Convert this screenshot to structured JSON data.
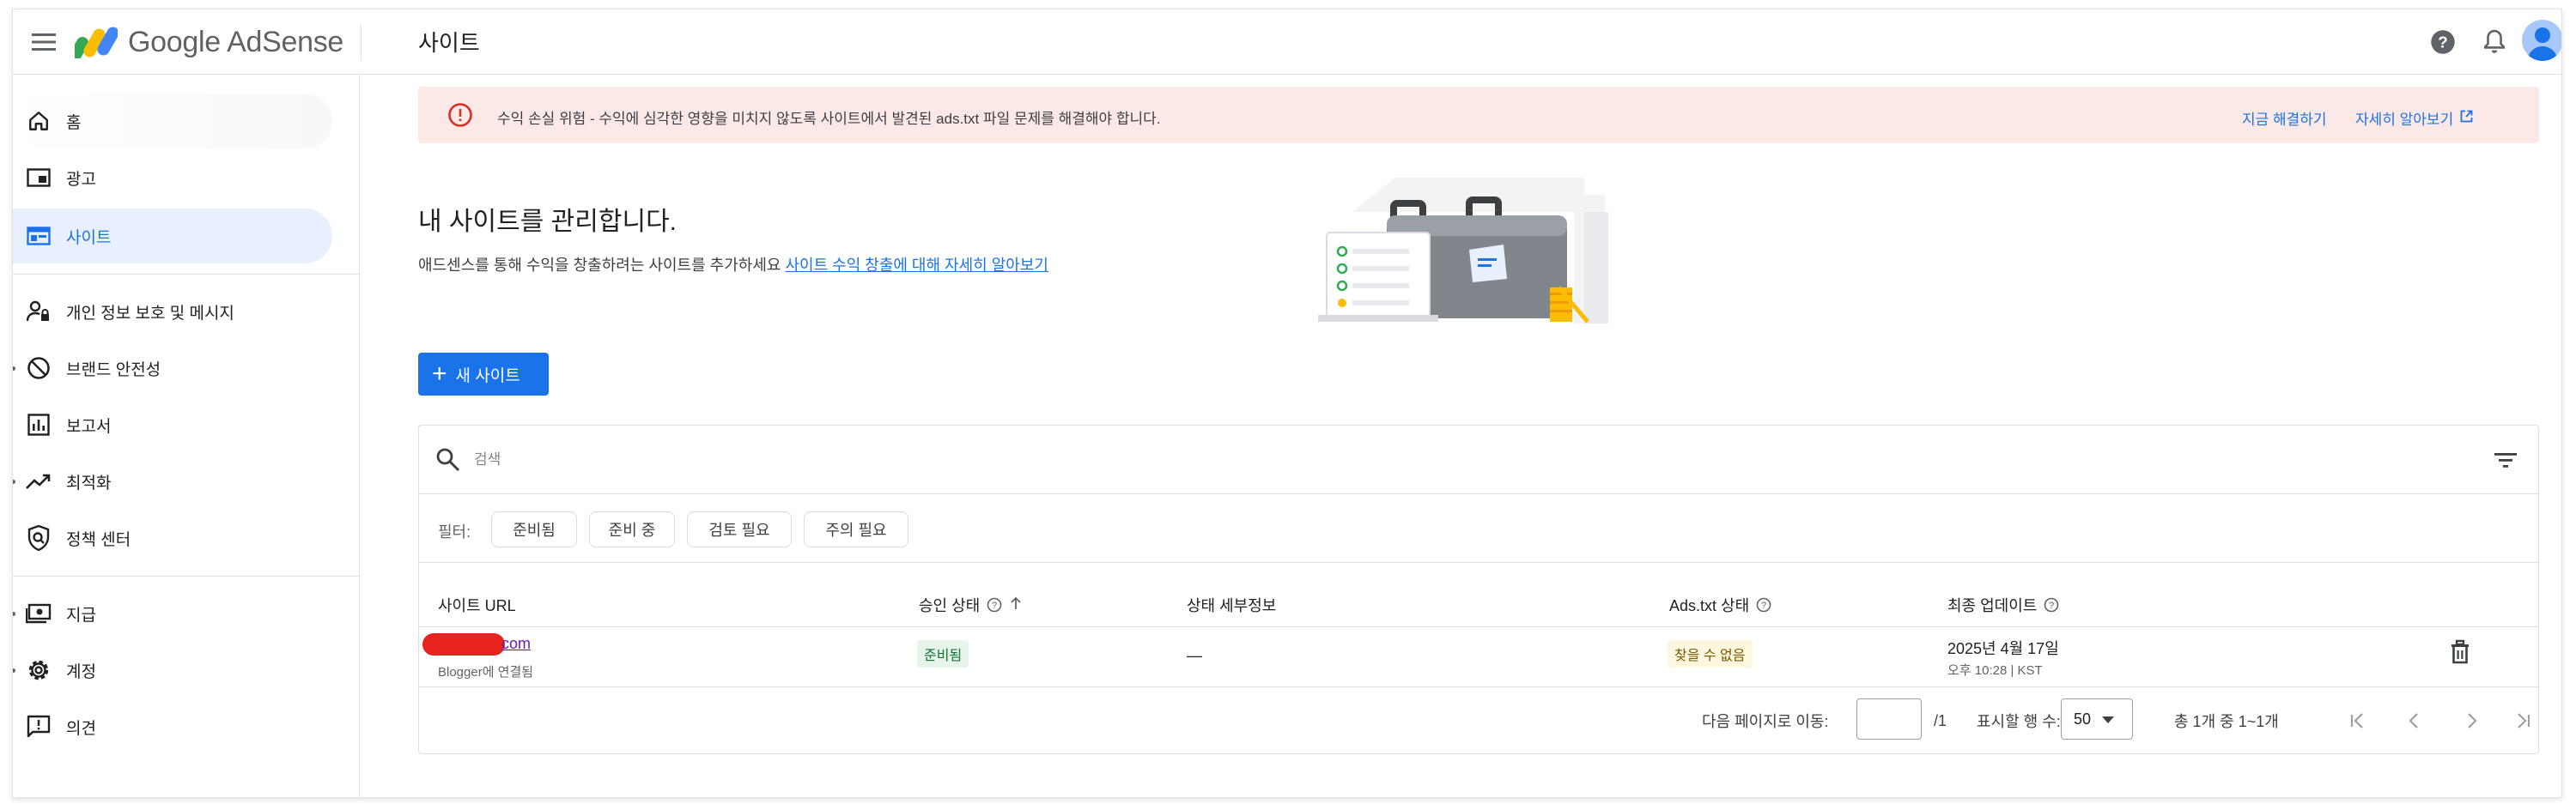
{
  "header": {
    "brand_google": "Google",
    "brand_product": "AdSense",
    "page_title": "사이트",
    "icons": [
      "menu-icon",
      "help-icon",
      "bell-icon",
      "avatar"
    ]
  },
  "sidebar": {
    "items": [
      {
        "label": "홈",
        "icon": "home-icon"
      },
      {
        "label": "광고",
        "icon": "ads-icon"
      },
      {
        "label": "사이트",
        "icon": "sites-icon",
        "active": true
      },
      {
        "label": "개인 정보 보호 및 메시지",
        "icon": "privacy-icon"
      },
      {
        "label": "브랜드 안전성",
        "icon": "brand-safety-icon"
      },
      {
        "label": "보고서",
        "icon": "reports-icon"
      },
      {
        "label": "최적화",
        "icon": "optimization-icon"
      },
      {
        "label": "정책 센터",
        "icon": "policy-icon"
      },
      {
        "label": "지급",
        "icon": "payments-icon"
      },
      {
        "label": "계정",
        "icon": "account-icon"
      },
      {
        "label": "의견",
        "icon": "feedback-icon"
      }
    ]
  },
  "alert": {
    "text": "수익 손실 위험 - 수익에 심각한 영향을 미치지 않도록 사이트에서 발견된 ads.txt 파일 문제를 해결해야 합니다.",
    "fix_now": "지금 해결하기",
    "learn_more": "자세히 알아보기"
  },
  "main": {
    "heading": "내 사이트를 관리합니다.",
    "subtext": "애드센스를 통해 수익을 창출하려는 사이트를 추가하세요 ",
    "subtext_link": "사이트 수익 창출에 대해 자세히 알아보기",
    "new_site_button": "새 사이트"
  },
  "table": {
    "search_placeholder": "검색",
    "filter_label": "필터:",
    "chips": [
      "준비됨",
      "준비 중",
      "검토 필요",
      "주의 필요"
    ],
    "columns": {
      "site_url": "사이트 URL",
      "approval_status": "승인 상태",
      "status_details": "상태 세부정보",
      "ads_txt_status": "Ads.txt 상태",
      "last_updated": "최종 업데이트"
    },
    "rows": [
      {
        "site_url_suffix": "com",
        "site_sub": "Blogger에 연결됨",
        "approval_status": "준비됨",
        "status_details": "—",
        "ads_txt_status": "찾을 수 없음",
        "last_updated_date": "2025년 4월 17일",
        "last_updated_time": "오후 10:28 | KST"
      }
    ],
    "pagination": {
      "goto_label": "다음 페이지로 이동:",
      "goto_value": "",
      "total_pages": "/1",
      "rows_per_page_label": "표시할 행 수:",
      "rows_per_page": "50",
      "range_text": "총 1개 중 1~1개"
    }
  },
  "colors": {
    "accent": "#1a73e8",
    "alert_bg": "#fce8e6",
    "alert_icon": "#d93025",
    "ready_badge_bg": "#e6f4ea",
    "ready_badge_text": "#137333",
    "warning_badge_bg": "#fef7e0",
    "warning_badge_text": "#7a5a00",
    "active_nav_bg": "#e8f0fe"
  }
}
